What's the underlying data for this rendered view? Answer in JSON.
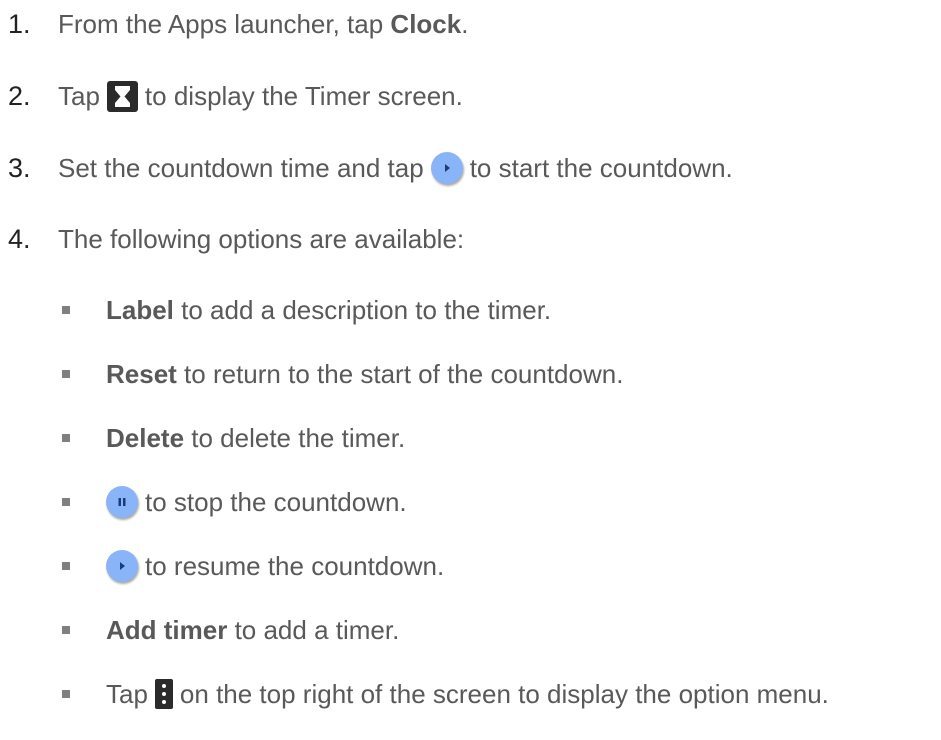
{
  "steps": [
    {
      "number": "1.",
      "text_a": "From the Apps launcher, tap ",
      "bold": "Clock",
      "text_b": "."
    },
    {
      "number": "2.",
      "text_a": "Tap",
      "icon": "hourglass-icon",
      "text_b": "to display the Timer screen."
    },
    {
      "number": "3.",
      "text_a": "Set the countdown time and tap",
      "icon": "play-button-icon",
      "text_b": "to start the countdown."
    },
    {
      "number": "4.",
      "text_a": "The following options are available:"
    }
  ],
  "options": [
    {
      "bold": "Label",
      "text": " to add a description to the timer."
    },
    {
      "bold": "Reset",
      "text": " to return to the start of the countdown."
    },
    {
      "bold": "Delete",
      "text": " to delete the timer."
    },
    {
      "icon": "pause-button-icon",
      "text": "to stop the countdown."
    },
    {
      "icon": "play-button-icon",
      "text": "to resume the countdown."
    },
    {
      "bold": "Add timer",
      "text": " to add a timer."
    },
    {
      "text_a": "Tap",
      "icon": "more-vertical-icon",
      "text": "on the top right of the screen to display the option menu."
    }
  ],
  "colors": {
    "body_text": "#595959",
    "number_text": "#222222",
    "accent_button": "#8ab4f8",
    "dark_icon_bg": "#2b2b2b",
    "bullet": "#7f7f7f"
  }
}
